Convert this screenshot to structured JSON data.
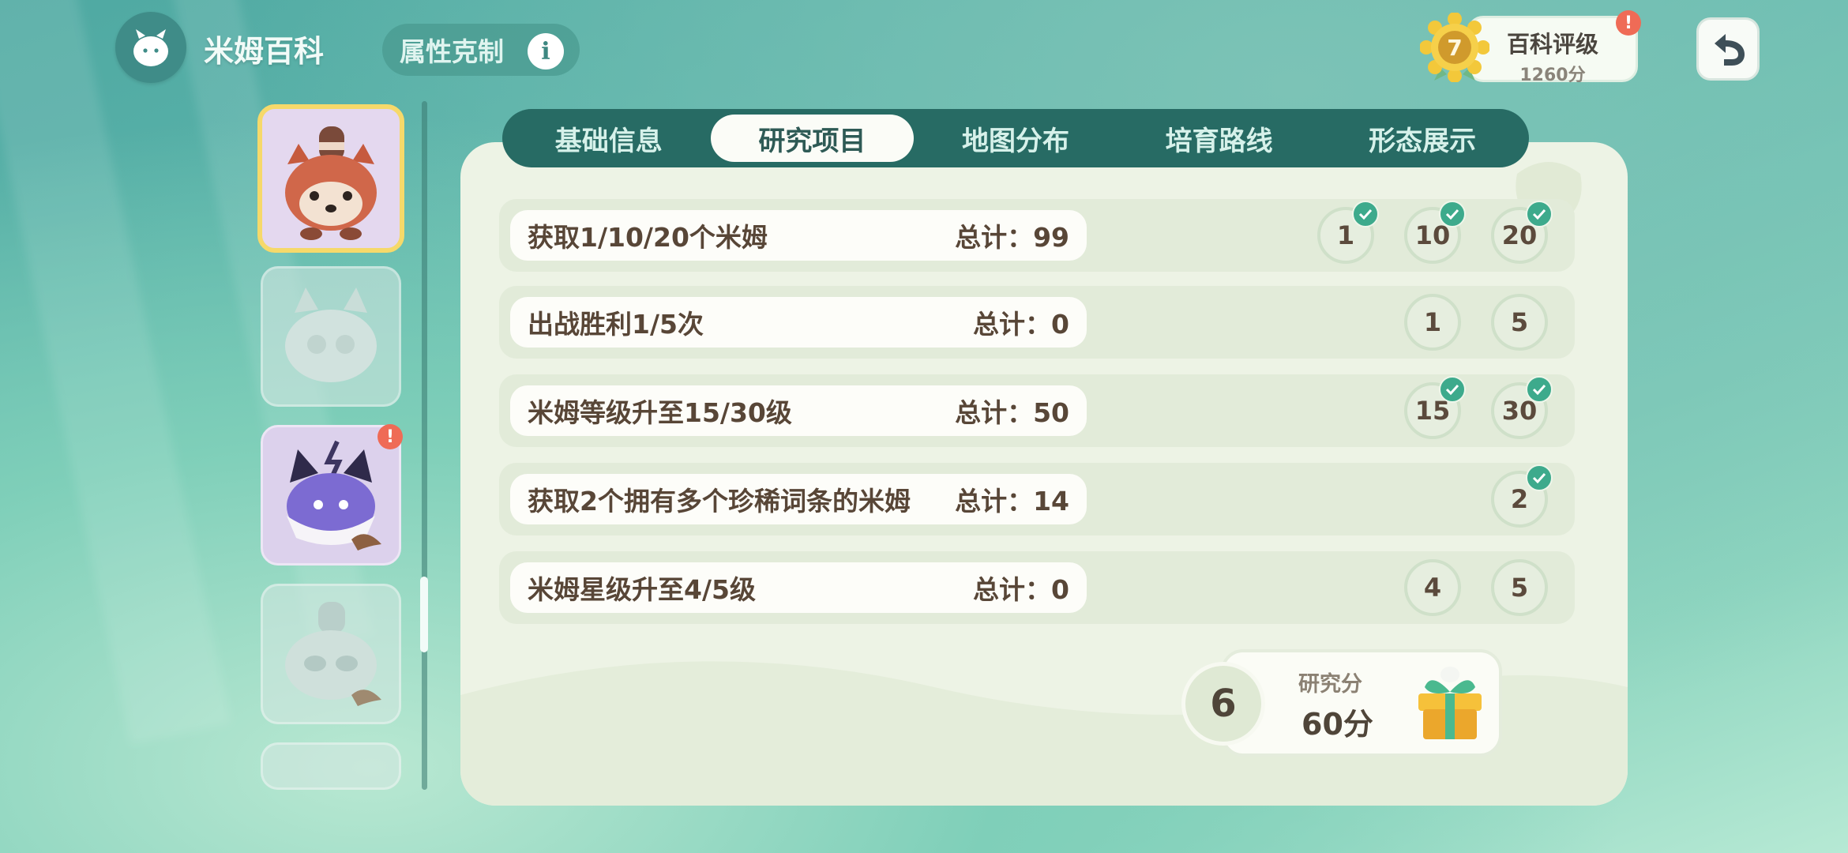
{
  "app": {
    "title": "米姆百科"
  },
  "header": {
    "type_chart_label": "属性克制",
    "rank": {
      "level": "7",
      "title": "百科评级",
      "score": "1260分",
      "alert": "!"
    }
  },
  "creatures": {
    "card_alert": "!"
  },
  "tabs": [
    {
      "label": "基础信息",
      "active": false
    },
    {
      "label": "研究项目",
      "active": true
    },
    {
      "label": "地图分布",
      "active": false
    },
    {
      "label": "培育路线",
      "active": false
    },
    {
      "label": "形态展示",
      "active": false
    }
  ],
  "research": [
    {
      "task": "获取1/10/20个米姆",
      "total": "总计：99",
      "milestones": [
        {
          "value": "1",
          "done": true
        },
        {
          "value": "10",
          "done": true
        },
        {
          "value": "20",
          "done": true
        }
      ]
    },
    {
      "task": "出战胜利1/5次",
      "total": "总计：0",
      "milestones": [
        {
          "value": "1",
          "done": false
        },
        {
          "value": "5",
          "done": false
        }
      ]
    },
    {
      "task": "米姆等级升至15/30级",
      "total": "总计：50",
      "milestones": [
        {
          "value": "15",
          "done": true
        },
        {
          "value": "30",
          "done": true
        }
      ]
    },
    {
      "task": "获取2个拥有多个珍稀词条的米姆",
      "total": "总计：14",
      "milestones": [
        {
          "value": "2",
          "done": true
        }
      ]
    },
    {
      "task": "米姆星级升至4/5级",
      "total": "总计：0",
      "milestones": [
        {
          "value": "4",
          "done": false
        },
        {
          "value": "5",
          "done": false
        }
      ]
    }
  ],
  "reward": {
    "level": "6",
    "label": "研究分",
    "points": "60分"
  },
  "colors": {
    "accent": "#276b64",
    "panel": "#edf3e5",
    "check": "#3daa8c",
    "alert": "#ef6b56"
  }
}
